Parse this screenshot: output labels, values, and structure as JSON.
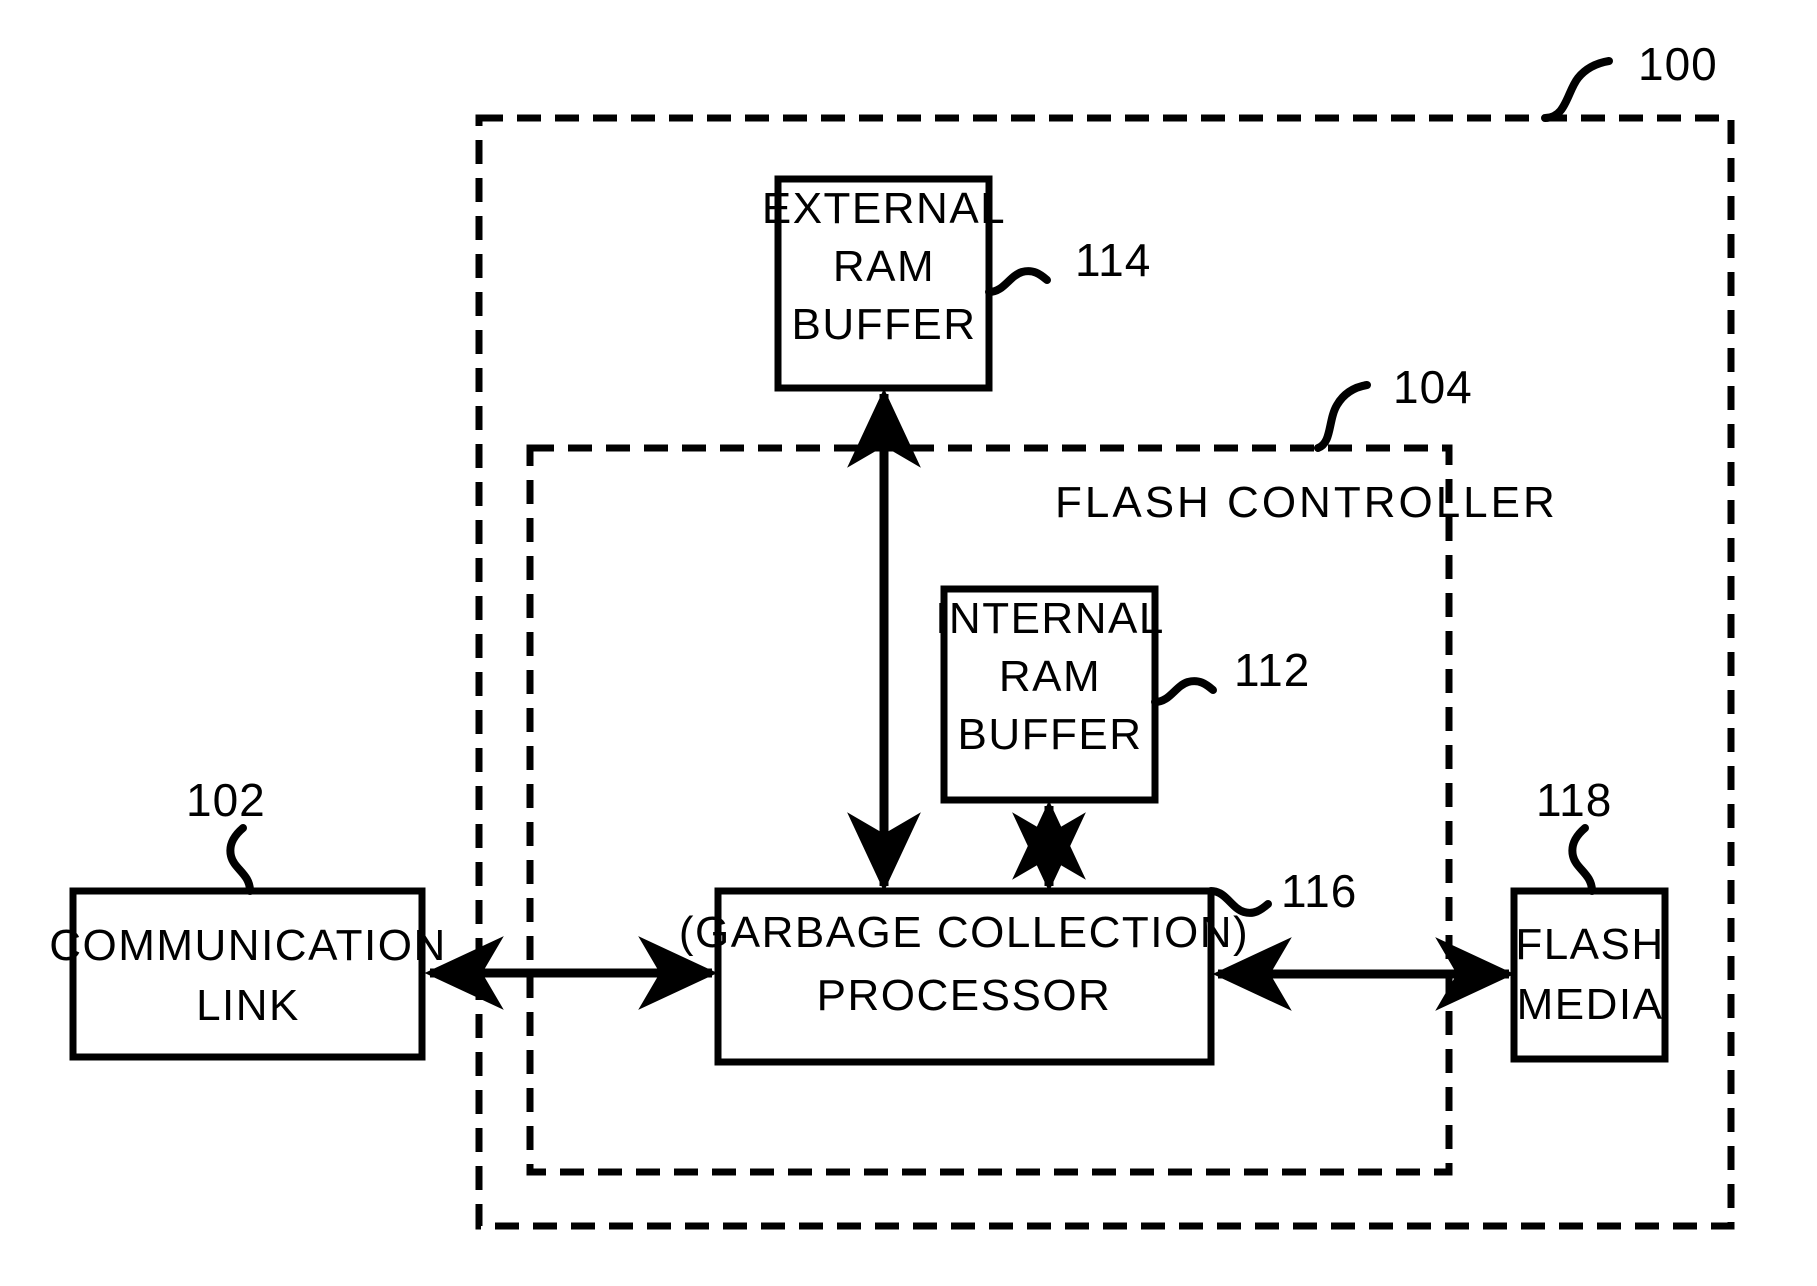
{
  "figure": {
    "title": "Flash storage device block diagram",
    "reference_numerals": {
      "system": "100",
      "communication_link": "102",
      "flash_controller": "104",
      "internal_ram_buffer": "112",
      "external_ram_buffer": "114",
      "processor": "116",
      "flash_media": "118"
    },
    "containers": [
      {
        "id": "system-boundary",
        "label": "",
        "ref": "100",
        "style": "dashed"
      },
      {
        "id": "flash-controller",
        "label": "FLASH CONTROLLER",
        "ref": "104",
        "style": "dashed"
      }
    ],
    "blocks": [
      {
        "id": "external-ram-buffer",
        "lines": [
          "EXTERNAL",
          "RAM",
          "BUFFER"
        ],
        "ref": "114"
      },
      {
        "id": "internal-ram-buffer",
        "lines": [
          "INTERNAL",
          "RAM",
          "BUFFER"
        ],
        "ref": "112"
      },
      {
        "id": "processor",
        "lines": [
          "(GARBAGE  COLLECTION)",
          "PROCESSOR"
        ],
        "ref": "116"
      },
      {
        "id": "communication-link",
        "lines": [
          "COMMUNICATION",
          "LINK"
        ],
        "ref": "102"
      },
      {
        "id": "flash-media",
        "lines": [
          "FLASH",
          "MEDIA"
        ],
        "ref": "118"
      }
    ],
    "connections": [
      {
        "id": "link-to-processor",
        "from": "communication-link",
        "to": "processor",
        "arrow": "double"
      },
      {
        "id": "processor-to-flash-media",
        "from": "processor",
        "to": "flash-media",
        "arrow": "double"
      },
      {
        "id": "processor-to-external-ram",
        "from": "processor",
        "to": "external-ram-buffer",
        "arrow": "double"
      },
      {
        "id": "processor-to-internal-ram",
        "from": "processor",
        "to": "internal-ram-buffer",
        "arrow": "double"
      }
    ],
    "colors": {
      "stroke": "#000000",
      "background": "#ffffff"
    }
  }
}
